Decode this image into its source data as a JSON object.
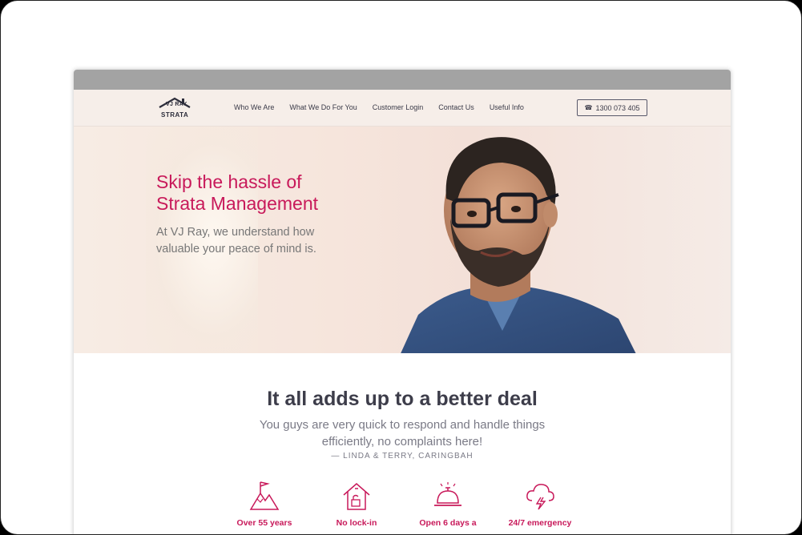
{
  "header": {
    "logo_top": "VJ RAY",
    "logo_bottom": "STRATA",
    "nav": [
      "Who We Are",
      "What We Do For You",
      "Customer Login",
      "Contact Us",
      "Useful Info"
    ],
    "phone": "1300 073 405"
  },
  "hero": {
    "title_line1": "Skip the hassle of",
    "title_line2": "Strata Management",
    "subtitle_line1": "At VJ Ray, we understand how",
    "subtitle_line2": "valuable your peace of mind is."
  },
  "section": {
    "heading": "It all adds up to a better deal",
    "quote_line1": "You guys are very quick to respond and handle things",
    "quote_line2": "efficiently, no complaints here!",
    "quote_author": "— LINDA & TERRY, CARINGBAH"
  },
  "features": [
    {
      "label": "Over 55 years",
      "icon": "mountain-flag-icon"
    },
    {
      "label": "No lock-in",
      "icon": "house-lock-icon"
    },
    {
      "label": "Open 6 days a",
      "icon": "service-bell-icon"
    },
    {
      "label": "24/7 emergency",
      "icon": "storm-cloud-icon"
    }
  ],
  "colors": {
    "accent": "#c8195a",
    "header_bg": "#f6eee9",
    "text_dark": "#3d3d4a"
  }
}
